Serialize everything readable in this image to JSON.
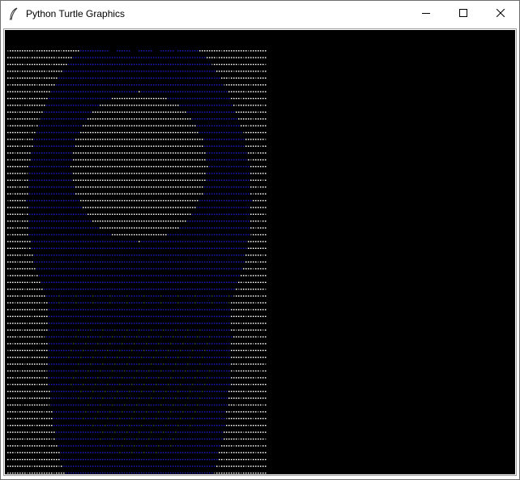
{
  "window": {
    "title": "Python Turtle Graphics",
    "app_icon": "feather-icon",
    "controls": [
      "minimize-icon",
      "maximize-icon",
      "close-icon"
    ]
  },
  "canvas": {
    "background": "#000000",
    "dot_color_bright": "#ffffff",
    "dot_color_mid": "#8a8a8a",
    "dot_color_blue": "#1a1ab8",
    "dot_color_green": "#2e5e2e",
    "description_art": "ascii-style dotted turtle drawing"
  }
}
